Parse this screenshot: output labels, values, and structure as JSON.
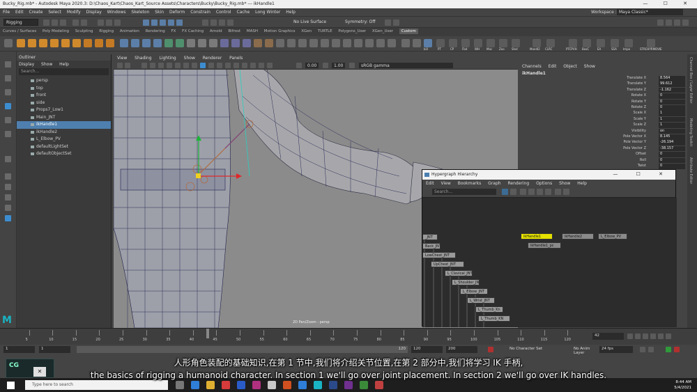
{
  "window": {
    "title": "Bucky_Rig.mb* - Autodesk Maya 2020.3: D:\\Chaos_Kart\\Chaos_Kart_Source Assets\\Characters\\Bucky\\Bucky_Rig.mb* --- ikHandle1",
    "controls": "— ☐ ✕"
  },
  "menus": [
    "File",
    "Edit",
    "Create",
    "Select",
    "Modify",
    "Display",
    "Windows",
    "Skeleton",
    "Skin",
    "Deform",
    "Constrain",
    "Control",
    "Cache",
    "Long Winter",
    "Help"
  ],
  "workspace": {
    "label": "Workspace :",
    "value": "Maya Classic*"
  },
  "status": {
    "menuset": "Rigging",
    "live_surface": "No Live Surface",
    "symmetry": "Symmetry: Off"
  },
  "shelf_tabs": [
    "Curves / Surfaces",
    "Poly Modeling",
    "Sculpting",
    "Rigging",
    "Animation",
    "Rendering",
    "FX",
    "FX Caching",
    "Arnold",
    "Bifrost",
    "MASH",
    "Motion Graphics",
    "XGen",
    "TURTLE",
    "Polygons_User",
    "XGen_User",
    "Custom"
  ],
  "shelf_active": "Custom",
  "shelf_labels": [
    "bill",
    "PT",
    "CP",
    "Fbd",
    "WH",
    "Mac",
    "Zoo",
    "Shel",
    "Mandl2",
    "CLRC",
    "PTCPVH",
    "BoxC",
    "EA",
    "SSA",
    "Impo",
    "STRCHYRMOVIE"
  ],
  "outliner": {
    "title": "Outliner",
    "menu": [
      "Display",
      "Show",
      "Help"
    ],
    "search_placeholder": "Search...",
    "items": [
      {
        "label": "persp",
        "selected": false
      },
      {
        "label": "top",
        "selected": false
      },
      {
        "label": "front",
        "selected": false
      },
      {
        "label": "side",
        "selected": false
      },
      {
        "label": "Props7_Low1",
        "selected": false
      },
      {
        "label": "Main_JNT",
        "selected": false
      },
      {
        "label": "ikHandle1",
        "selected": true
      },
      {
        "label": "ikHandle2",
        "selected": false
      },
      {
        "label": "L_Elbow_PV",
        "selected": false
      },
      {
        "label": "defaultLightSet",
        "selected": false
      },
      {
        "label": "defaultObjectSet",
        "selected": false
      }
    ]
  },
  "viewport": {
    "menu": [
      "View",
      "Shading",
      "Lighting",
      "Show",
      "Renderer",
      "Panels"
    ],
    "near": "0.00",
    "far": "1.00",
    "color_space": "sRGB gamma",
    "camera_label": "2D Pan/Zoom : persp"
  },
  "channel_box": {
    "menu": [
      "Channels",
      "Edit",
      "Object",
      "Show"
    ],
    "object": "ikHandle1",
    "attrs": [
      {
        "label": "Translate X",
        "value": "8.564"
      },
      {
        "label": "Translate Y",
        "value": "99.612"
      },
      {
        "label": "Translate Z",
        "value": "-1.162"
      },
      {
        "label": "Rotate X",
        "value": "0"
      },
      {
        "label": "Rotate Y",
        "value": "0"
      },
      {
        "label": "Rotate Z",
        "value": "0"
      },
      {
        "label": "Scale X",
        "value": "1"
      },
      {
        "label": "Scale Y",
        "value": "1"
      },
      {
        "label": "Scale Z",
        "value": "1"
      },
      {
        "label": "Visibility",
        "value": "on"
      },
      {
        "label": "Pole Vector X",
        "value": "8.145"
      },
      {
        "label": "Pole Vector Y",
        "value": "-26.194"
      },
      {
        "label": "Pole Vector Z",
        "value": "-38.157"
      },
      {
        "label": "Offset",
        "value": "0"
      },
      {
        "label": "Roll",
        "value": "0"
      },
      {
        "label": "Twist",
        "value": "0"
      }
    ],
    "side_tabs": [
      "Channel Box / Layer Editor",
      "Modeling Toolkit",
      "Attribute Editor"
    ]
  },
  "hypergraph": {
    "title": "Hypergraph Hierarchy",
    "window_controls": "— ☐ ✕",
    "menu": [
      "Edit",
      "View",
      "Bookmarks",
      "Graph",
      "Rendering",
      "Options",
      "Show",
      "Help"
    ],
    "search_placeholder": "Search...",
    "nodes": [
      {
        "label": "_JNT",
        "style": "normal"
      },
      {
        "label": "Back_JNT",
        "style": "normal"
      },
      {
        "label": "LowChest_JNT",
        "style": "normal"
      },
      {
        "label": "UpChest_JNT",
        "style": "normal"
      },
      {
        "label": "L_Clavical_JNT",
        "style": "normal"
      },
      {
        "label": "L_Shoulder_JNT",
        "style": "normal"
      },
      {
        "label": "L_Elbow_JNT",
        "style": "normal"
      },
      {
        "label": "L_Wrist_JNT",
        "style": "normal"
      },
      {
        "label": "L_Thumb_Kn",
        "style": "normal"
      },
      {
        "label": "L_Thumb_KN",
        "style": "normal"
      },
      {
        "label": "ikHandle1",
        "style": "highlight"
      },
      {
        "label": "ikHandle1_pc",
        "style": "dark"
      },
      {
        "label": "ikHandle2",
        "style": "dark"
      },
      {
        "label": "L_Elbow_PV",
        "style": "dark"
      }
    ]
  },
  "timeline": {
    "ticks": [
      "5",
      "10",
      "15",
      "20",
      "25",
      "30",
      "35",
      "40",
      "45",
      "50",
      "55",
      "60",
      "65",
      "70",
      "75",
      "80",
      "85",
      "90",
      "95",
      "100",
      "105",
      "110",
      "115",
      "120"
    ],
    "current_frame": "42"
  },
  "range": {
    "start": "1",
    "start_inner": "1",
    "slider_end": "120",
    "end": "120",
    "end_outer": "200",
    "character_set": "No Character Set",
    "anim_layer": "No Anim Layer",
    "fps": "24 fps"
  },
  "subtitles": {
    "zh": "人形角色装配的基础知识,在第 1 节中,我们将介绍关节位置,在第 2 部分中,我们将学习 IK 手柄,",
    "en": "the basics of rigging a humanoid character. In section 1 we'll go over joint placement. In section 2 we'll go over IK handles."
  },
  "thumbnail": {
    "close": "✕",
    "badge": "CG"
  },
  "taskbar": {
    "search_placeholder": "Type here to search",
    "time": "8:44 AM",
    "date": "5/4/2021"
  },
  "colors": {
    "accent": "#4e7fae",
    "highlight_node": "#e4e000",
    "maya_logo": "#19b3c3"
  }
}
